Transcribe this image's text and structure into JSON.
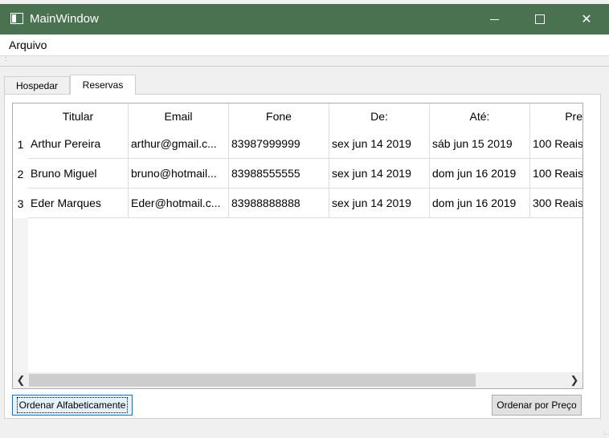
{
  "window": {
    "title": "MainWindow"
  },
  "menu": {
    "items": [
      "Arquivo"
    ]
  },
  "tabs": [
    {
      "label": "Hospedar",
      "active": false
    },
    {
      "label": "Reservas",
      "active": true
    }
  ],
  "table": {
    "columns": [
      "Titular",
      "Email",
      "Fone",
      "De:",
      "Até:",
      "Pre"
    ],
    "rows": [
      {
        "num": "1",
        "cells": [
          "Arthur Pereira",
          "arthur@gmail.c...",
          "83987999999",
          "sex jun 14 2019",
          "sáb jun 15 2019",
          "100 Reais"
        ]
      },
      {
        "num": "2",
        "cells": [
          "Bruno Miguel",
          "bruno@hotmail...",
          "83988555555",
          "sex jun 14 2019",
          "dom jun 16 2019",
          "100 Reais"
        ]
      },
      {
        "num": "3",
        "cells": [
          "Eder Marques",
          "Eder@hotmail.c...",
          "83988888888",
          "sex jun 14 2019",
          "dom jun 16 2019",
          "300 Reais"
        ]
      }
    ]
  },
  "buttons": {
    "sort_alpha": "Ordenar Alfabeticamente",
    "sort_price": "Ordenar por Preço"
  },
  "colors": {
    "titlebar": "#4a7250",
    "focus": "#0078d7"
  }
}
